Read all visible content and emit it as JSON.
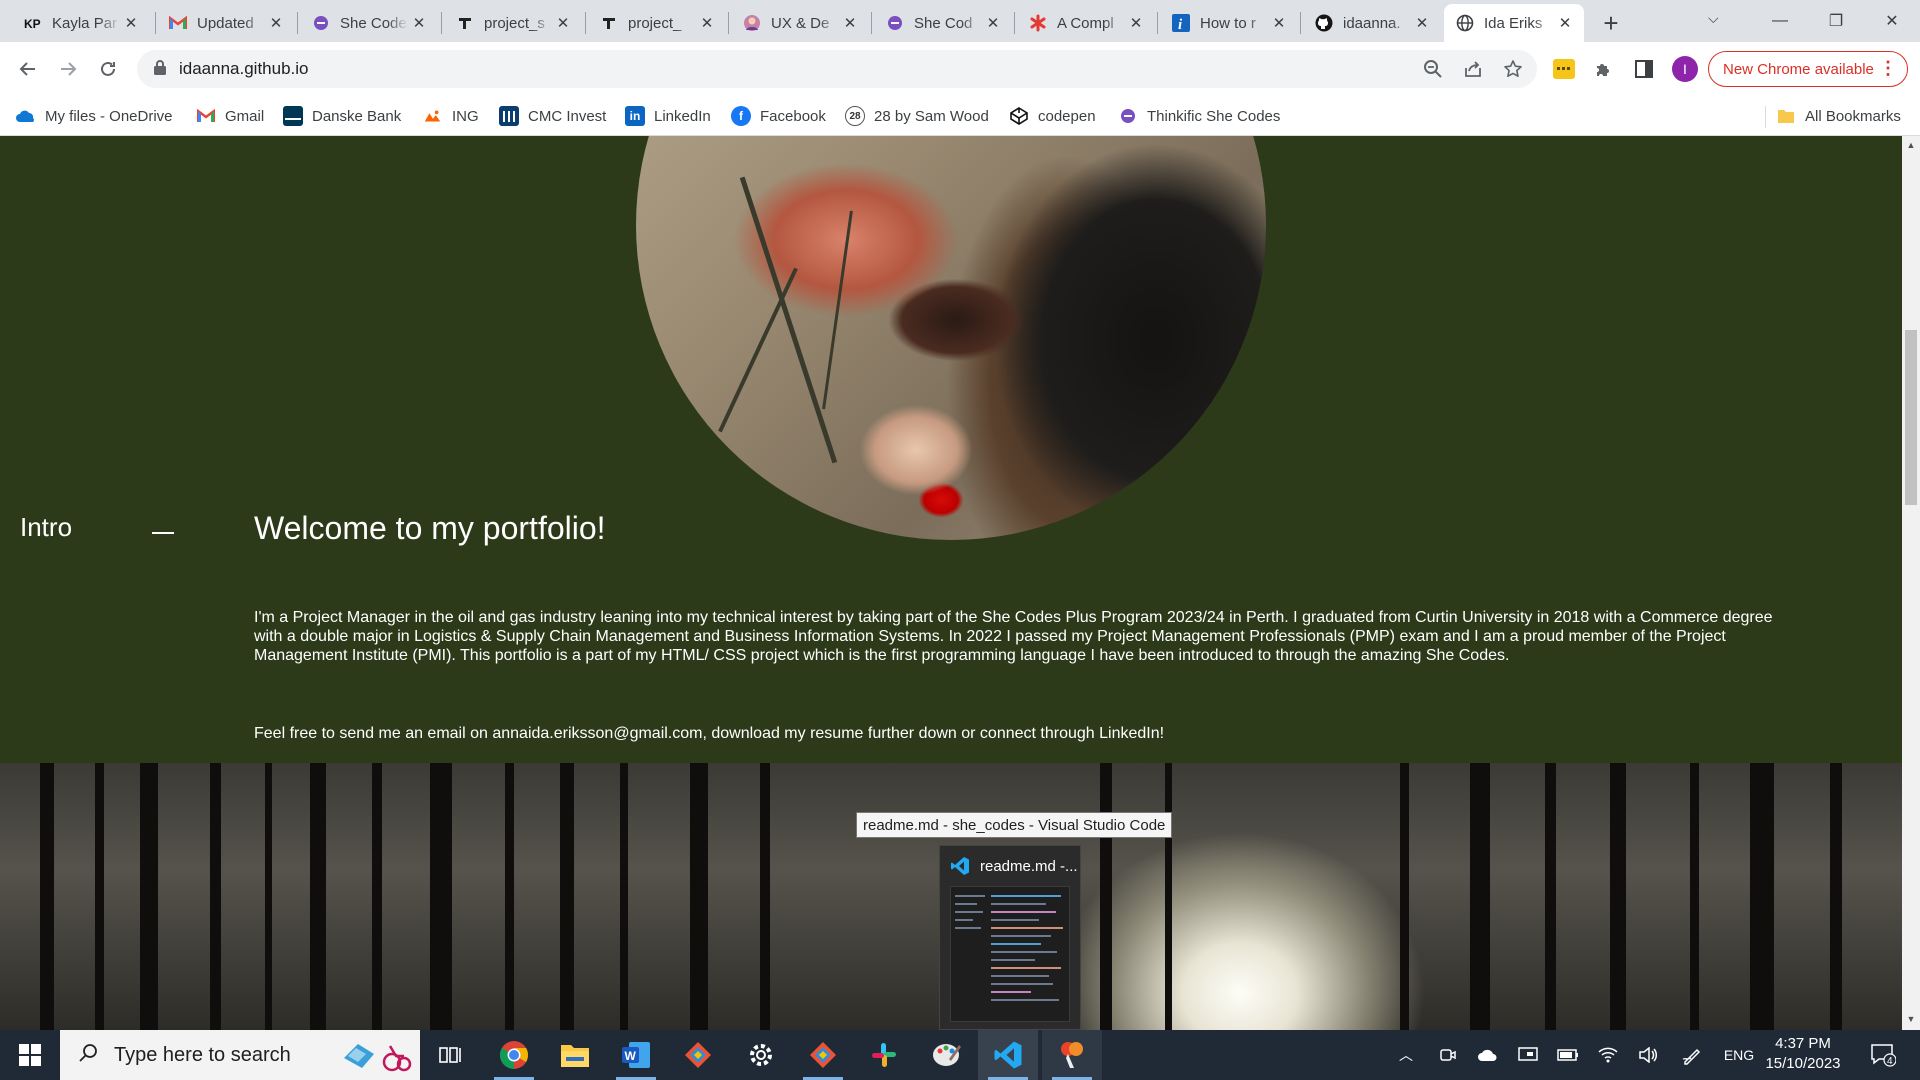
{
  "browser": {
    "tabs": [
      {
        "title": "Kayla Par",
        "favicon": "kp-icon"
      },
      {
        "title": "Updated",
        "favicon": "gmail-icon"
      },
      {
        "title": "She Code",
        "favicon": "shecodes-icon"
      },
      {
        "title": "project_s",
        "favicon": "tool-icon"
      },
      {
        "title": "project_",
        "favicon": "tool-icon"
      },
      {
        "title": "UX & De",
        "favicon": "avatar-icon"
      },
      {
        "title": "She Cod",
        "favicon": "shecodes-icon"
      },
      {
        "title": "A Compl",
        "favicon": "asterisk-icon"
      },
      {
        "title": "How to r",
        "favicon": "info-icon"
      },
      {
        "title": "idaanna.",
        "favicon": "github-icon"
      },
      {
        "title": "Ida Eriks",
        "favicon": "globe-icon",
        "active": true
      }
    ],
    "url": "idaanna.github.io",
    "update_button": "New Chrome available",
    "profile_initial": "I",
    "bookmarks": [
      {
        "label": "My files - OneDrive",
        "icon": "onedrive-icon"
      },
      {
        "label": "Gmail",
        "icon": "gmail-icon"
      },
      {
        "label": "Danske Bank",
        "icon": "danske-icon"
      },
      {
        "label": "ING",
        "icon": "ing-icon"
      },
      {
        "label": "CMC Invest",
        "icon": "cmc-icon"
      },
      {
        "label": "LinkedIn",
        "icon": "linkedin-icon"
      },
      {
        "label": "Facebook",
        "icon": "facebook-icon"
      },
      {
        "label": "28 by Sam Wood",
        "icon": "28-icon",
        "icon_text": "28"
      },
      {
        "label": "codepen",
        "icon": "codepen-icon"
      },
      {
        "label": "Thinkific She Codes",
        "icon": "thinkific-icon"
      }
    ],
    "all_bookmarks": "All Bookmarks"
  },
  "page": {
    "section_label": "Intro",
    "heading": "Welcome to my portfolio!",
    "paragraph_1": "I'm a Project Manager in the oil and gas industry leaning into my technical interest by taking part of the She Codes Plus Program 2023/24 in Perth. I graduated from Curtin University in 2018 with a Commerce degree with a double major in Logistics & Supply Chain Management and Business Information Systems. In 2022 I passed my Project Management Professionals (PMP) exam and I am a proud member of the Project Management Institute (PMI). This portfolio is a part of my HTML/ CSS project which is the first programming language I have been introduced to through the amazing She Codes.",
    "paragraph_2": "Feel free to send me an email on annaida.eriksson@gmail.com, download my resume further down or connect through LinkedIn!"
  },
  "overlay": {
    "tooltip": "readme.md - she_codes - Visual Studio Code",
    "preview_title": "readme.md -..."
  },
  "taskbar": {
    "search_placeholder": "Type here to search",
    "language": "ENG",
    "time": "4:37 PM",
    "date": "15/10/2023",
    "notification_count": "4"
  },
  "colors": {
    "page_background": "#2c3a1a",
    "update_red": "#d93025",
    "taskbar": "#1f2a36"
  }
}
